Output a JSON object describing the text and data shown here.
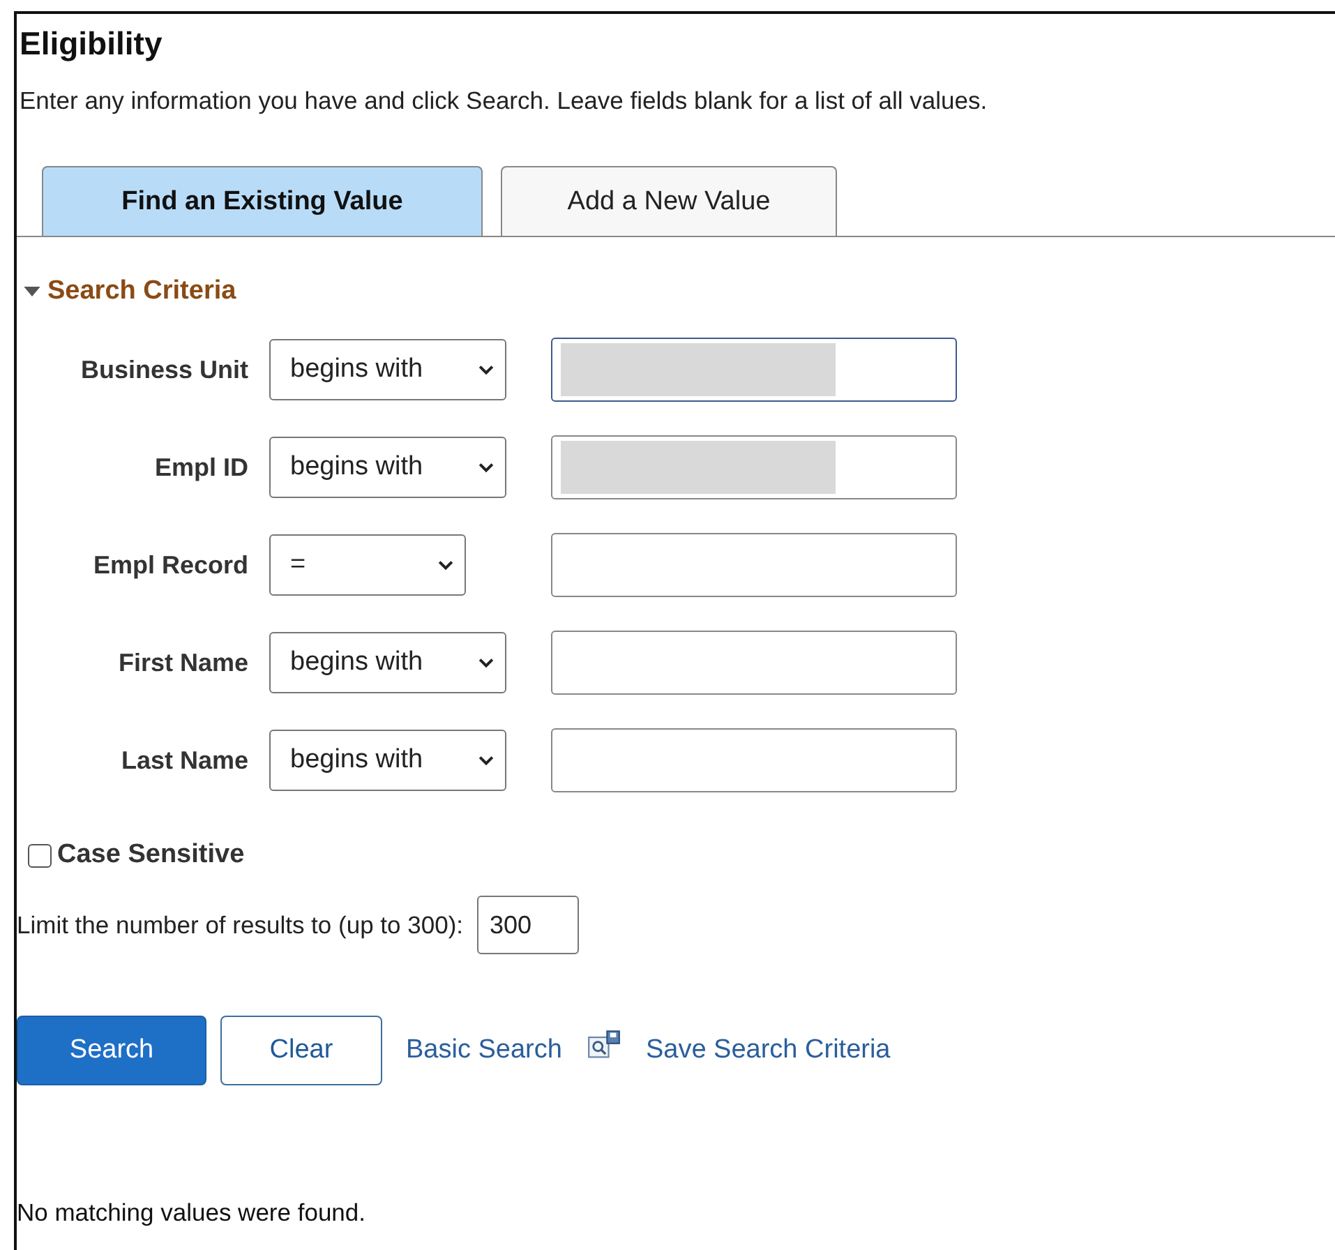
{
  "page": {
    "title": "Eligibility",
    "instructions": "Enter any information you have and click Search. Leave fields blank for a list of all values."
  },
  "tabs": [
    {
      "label": "Find an Existing Value",
      "selected": true
    },
    {
      "label": "Add a New Value",
      "selected": false
    }
  ],
  "section": {
    "title": "Search Criteria",
    "expanded": true
  },
  "criteria": [
    {
      "label": "Business Unit",
      "operator": "begins with",
      "redacted": true,
      "wide": true
    },
    {
      "label": "Empl ID",
      "operator": "begins with",
      "redacted": true,
      "wide": true
    },
    {
      "label": "Empl Record",
      "operator": "=",
      "redacted": false,
      "wide": false
    },
    {
      "label": "First Name",
      "operator": "begins with",
      "redacted": false,
      "wide": true
    },
    {
      "label": "Last Name",
      "operator": "begins with",
      "redacted": false,
      "wide": true
    }
  ],
  "case_sensitive": {
    "label": "Case Sensitive",
    "checked": false
  },
  "limit": {
    "label": "Limit the number of results to (up to 300):",
    "value": "300"
  },
  "actions": [
    {
      "kind": "primary",
      "label": "Search"
    },
    {
      "kind": "secondary",
      "label": "Clear"
    },
    {
      "kind": "link",
      "label": "Basic Search"
    },
    {
      "kind": "icon-link",
      "label": "Save Search Criteria"
    }
  ],
  "message": "No matching values were found."
}
